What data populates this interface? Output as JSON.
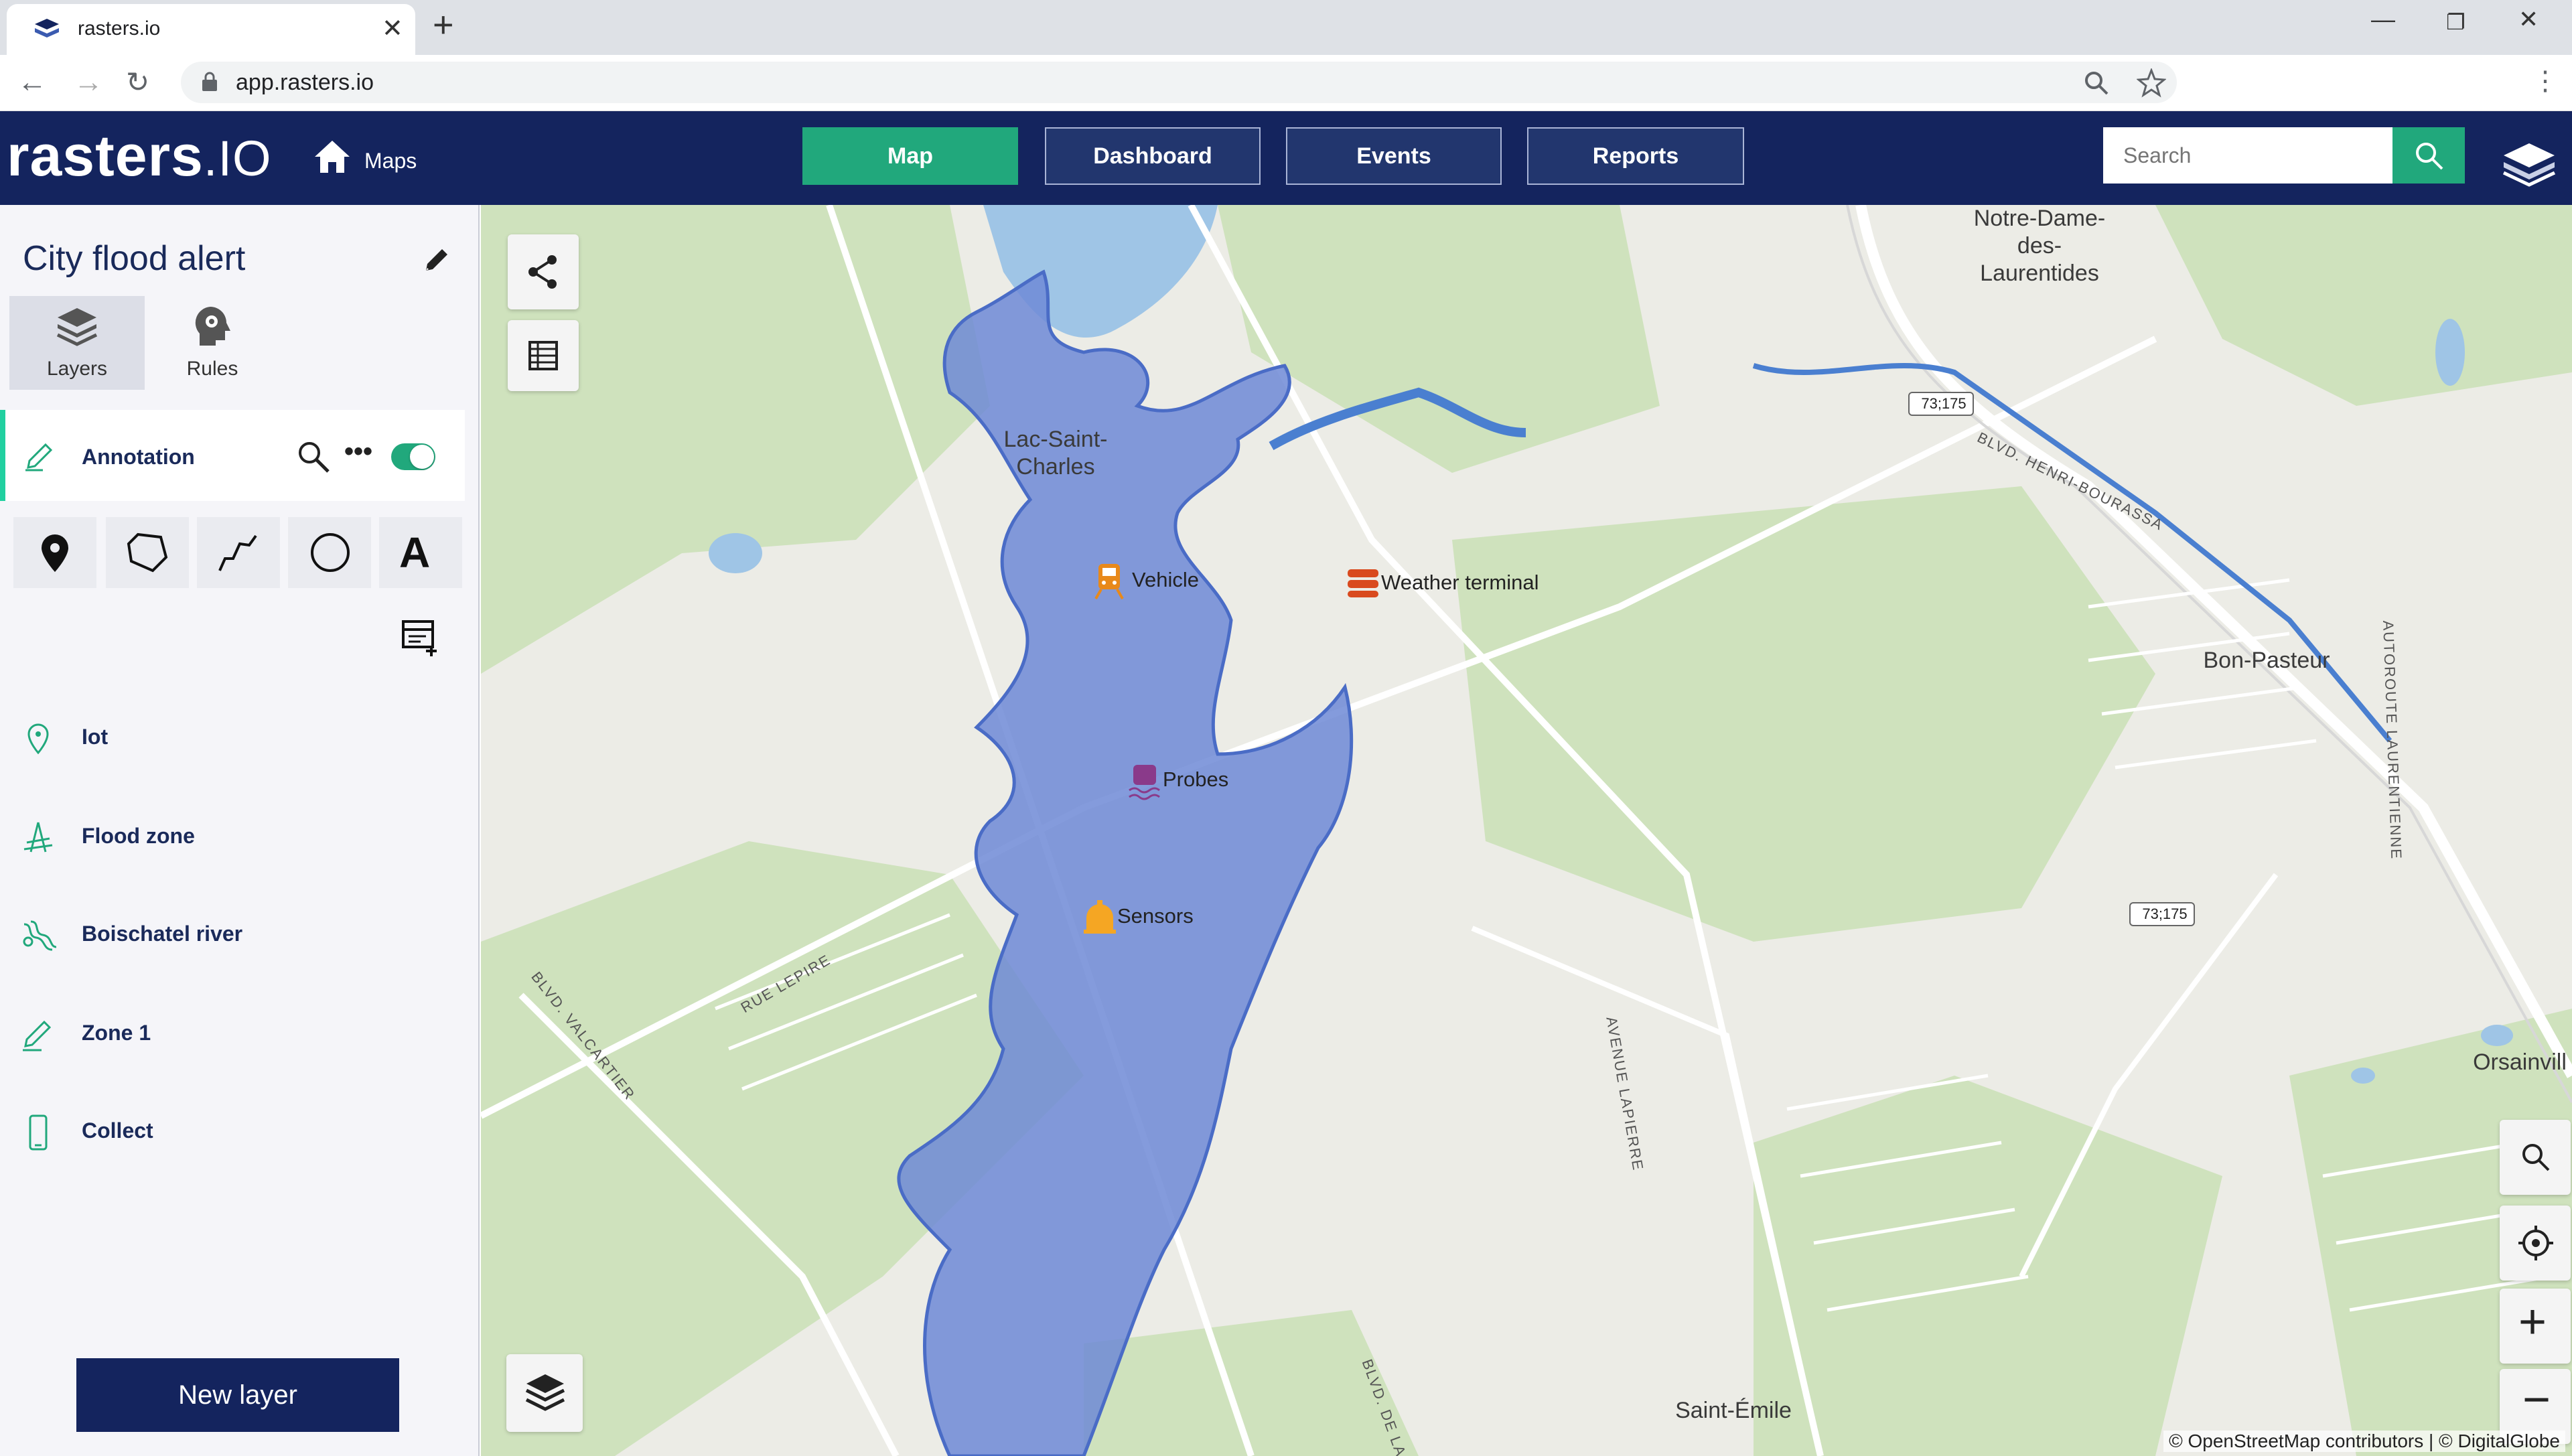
{
  "browser": {
    "tab_title": "rasters.io",
    "url": "app.rasters.io"
  },
  "header": {
    "logo_main": "rasters",
    "logo_dot_io": ".IO",
    "maps_link": "Maps",
    "nav": [
      {
        "label": "Map",
        "active": true
      },
      {
        "label": "Dashboard",
        "active": false
      },
      {
        "label": "Events",
        "active": false
      },
      {
        "label": "Reports",
        "active": false
      }
    ],
    "search_placeholder": "Search",
    "accent_color": "#21a87c",
    "bar_color": "#14245e"
  },
  "sidebar": {
    "map_title": "City flood alert",
    "tabs": [
      {
        "label": "Layers",
        "icon": "layers-icon",
        "active": true
      },
      {
        "label": "Rules",
        "icon": "rules-gear-head-icon",
        "active": false
      }
    ],
    "active_layer": {
      "label": "Annotation",
      "icon": "pen-icon",
      "visible": true
    },
    "tools": [
      "marker-icon",
      "polygon-icon",
      "polyline-icon",
      "circle-icon",
      "text-icon"
    ],
    "layers": [
      {
        "label": "Iot",
        "icon": "map-pin-icon"
      },
      {
        "label": "Flood zone",
        "icon": "flood-icon"
      },
      {
        "label": "Boischatel river",
        "icon": "river-icon"
      },
      {
        "label": "Zone 1",
        "icon": "pen-icon"
      },
      {
        "label": "Collect",
        "icon": "phone-icon"
      }
    ],
    "new_layer_label": "New layer"
  },
  "map": {
    "places": [
      "Lac-Saint-Charles",
      "Notre-Dame-des-Laurentides",
      "Bon-Pasteur",
      "Saint-Émile",
      "Orsainvill"
    ],
    "roads": [
      "BLVD. HENRI-BOURASSA",
      "AUTOROUTE LAURENTIENNE",
      "AVENUE LAPIERRE",
      "RUE LEPIRE",
      "BLVD. VALCARTIER",
      "BLVD. DE LA C"
    ],
    "shields": [
      "73;175",
      "73;175"
    ],
    "pois": [
      {
        "label": "Vehicle",
        "icon": "train-icon",
        "color": "#e8891a"
      },
      {
        "label": "Weather terminal",
        "icon": "weather-station-icon",
        "color": "#d94a1e"
      },
      {
        "label": "Probes",
        "icon": "probe-icon",
        "color": "#8a3a8a"
      },
      {
        "label": "Sensors",
        "icon": "sensor-icon",
        "color": "#f5a623"
      }
    ],
    "attribution": "© OpenStreetMap contributors | © DigitalGlobe",
    "flood_color": "#6f8ad6"
  }
}
